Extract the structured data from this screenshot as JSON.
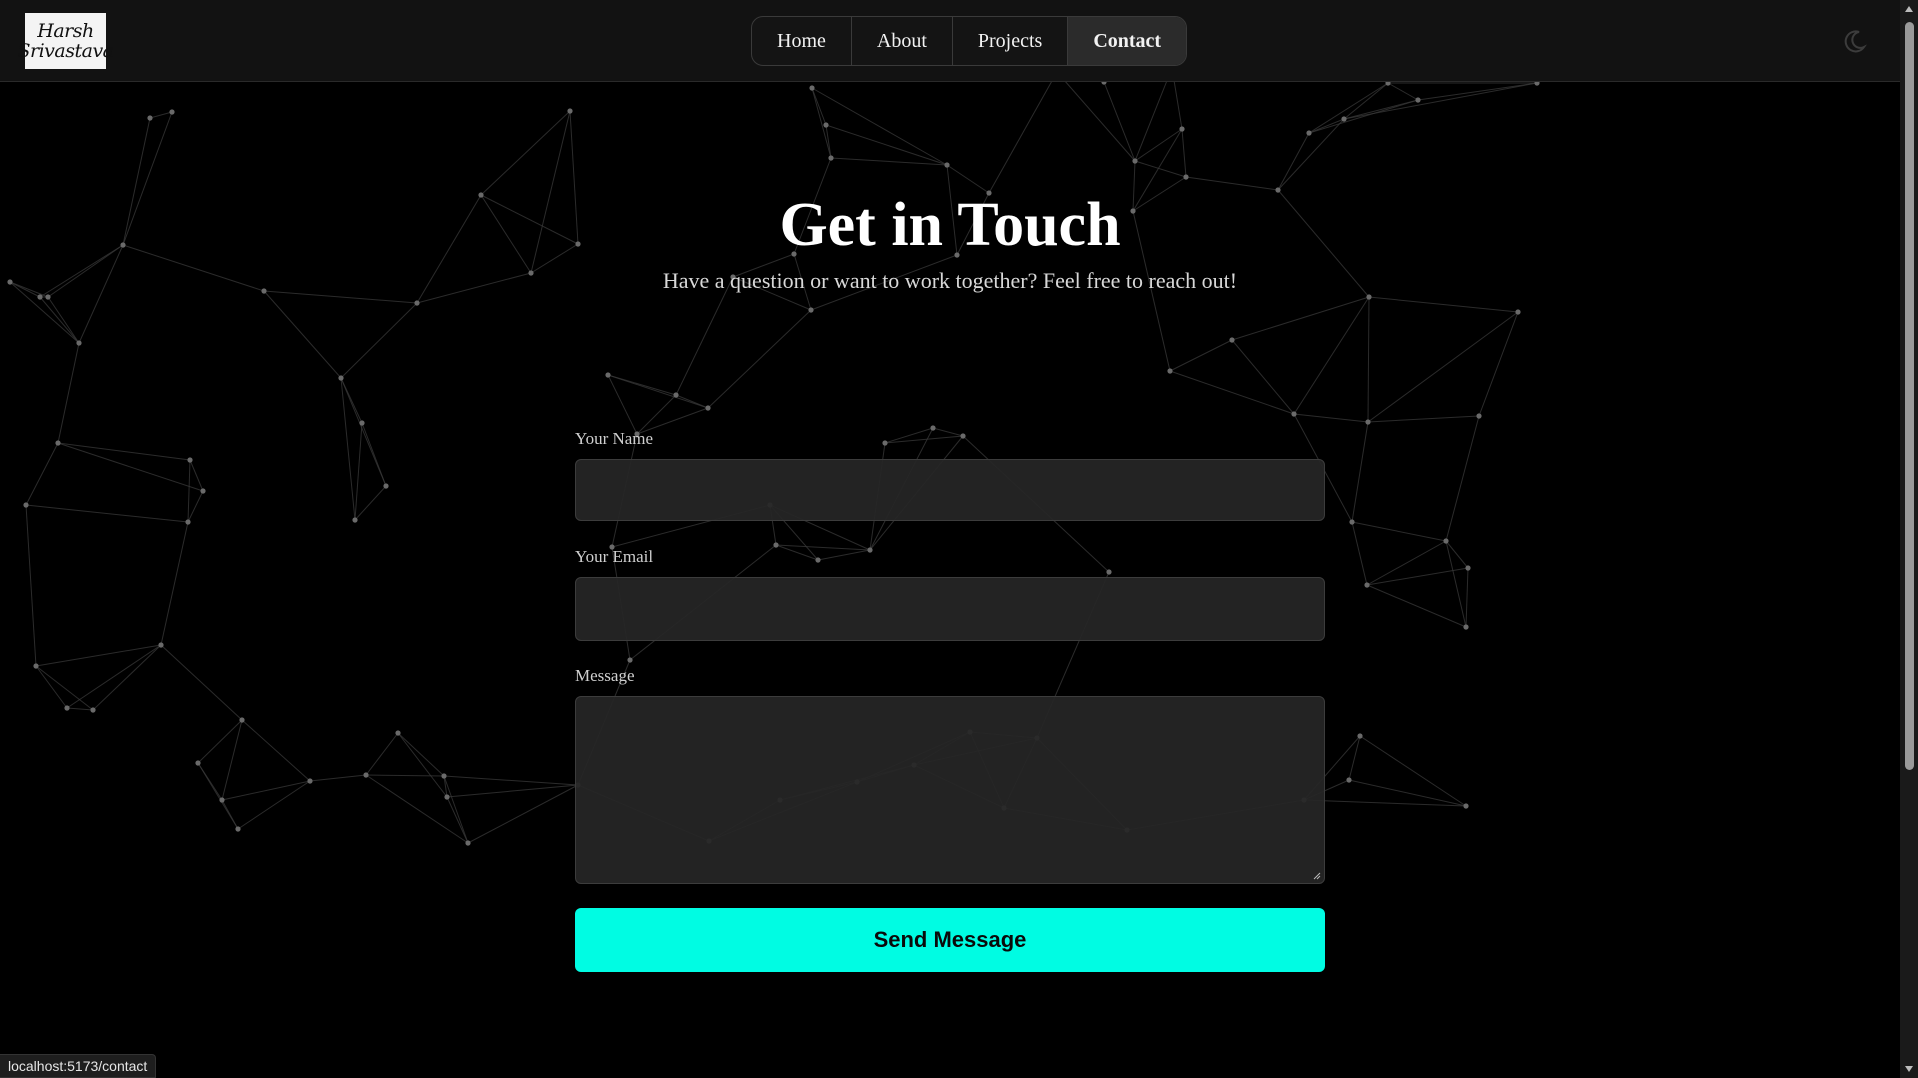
{
  "header": {
    "logo_text": "Harsh\nSrivastava",
    "nav": [
      {
        "label": "Home",
        "active": false
      },
      {
        "label": "About",
        "active": false
      },
      {
        "label": "Projects",
        "active": false
      },
      {
        "label": "Contact",
        "active": true
      }
    ],
    "theme_toggle_icon": "moon-icon"
  },
  "main": {
    "title": "Get in Touch",
    "subtitle": "Have a question or want to work together? Feel free to reach out!",
    "form": {
      "name_label": "Your Name",
      "name_value": "",
      "email_label": "Your Email",
      "email_value": "",
      "message_label": "Message",
      "message_value": "",
      "submit_label": "Send Message"
    }
  },
  "status_bar": {
    "url": "localhost:5173/contact"
  },
  "colors": {
    "background": "#000000",
    "header": "#121212",
    "field": "#262626",
    "accent": "#00fce3",
    "network_lines": "#3a3a3a"
  }
}
